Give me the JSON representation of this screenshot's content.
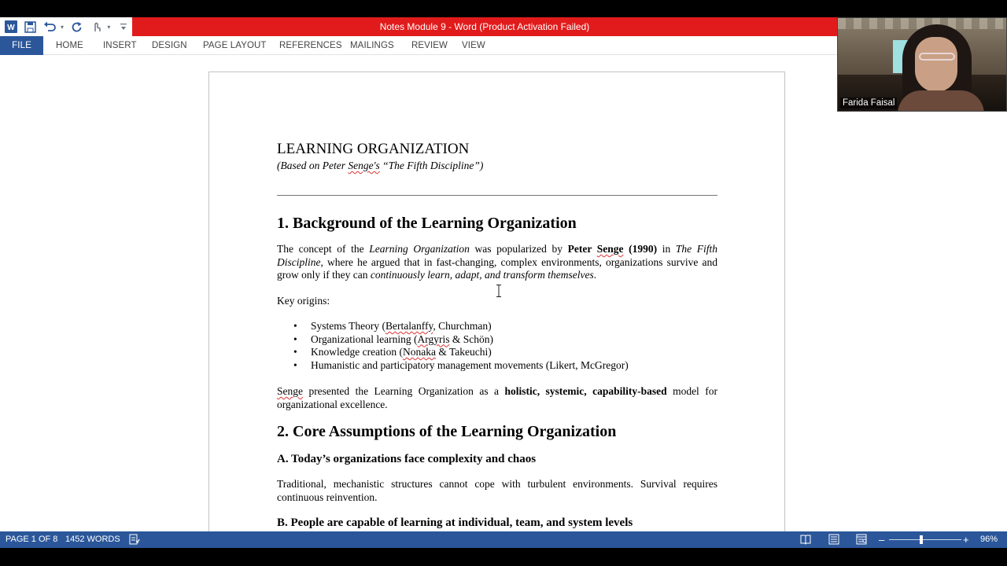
{
  "window": {
    "title": "Notes Module 9  -  Word (Product Activation Failed)"
  },
  "quick_access": {
    "icons": [
      "word-icon",
      "save-icon",
      "undo-icon",
      "redo-icon",
      "touch-mode-icon",
      "customize-icon"
    ]
  },
  "ribbon": {
    "tabs": [
      "FILE",
      "HOME",
      "INSERT",
      "DESIGN",
      "PAGE LAYOUT",
      "REFERENCES",
      "MAILINGS",
      "REVIEW",
      "VIEW"
    ]
  },
  "webcam": {
    "name": "Farida Faisal"
  },
  "document": {
    "title": "LEARNING ORGANIZATION",
    "subtitle_pre": "(Based on Peter ",
    "subtitle_senge": "Senge's",
    "subtitle_post": " “The Fifth Discipline”)",
    "section1": {
      "heading": "1. Background of the Learning Organization",
      "p1": {
        "a": "The concept of the ",
        "b": "Learning Organization",
        "c": " was popularized by ",
        "d": "Peter ",
        "e": "Senge",
        "f": " (1990)",
        "g": " in ",
        "h": "The Fifth Discipline",
        "i": ", where he argued that in fast-changing, complex environments, organizations survive and grow only if they can ",
        "j": "continuously learn, adapt, and transform themselves",
        "k": "."
      },
      "key_origins": "Key origins:",
      "origins": [
        {
          "a": "Systems Theory (",
          "b": "Bertalanffy",
          "c": ", Churchman)"
        },
        {
          "a": "Organizational learning (",
          "b": "Argyris",
          "c": " & Schön)"
        },
        {
          "a": "Knowledge creation (",
          "b": "Nonaka",
          "c": " & Takeuchi)"
        },
        {
          "a": "Humanistic and participatory management movements (Likert, McGregor)",
          "b": "",
          "c": ""
        }
      ],
      "p2": {
        "a": "Senge",
        "b": " presented the Learning Organization as a ",
        "c": "holistic, systemic, capability-based",
        "d": " model for organizational excellence."
      }
    },
    "section2": {
      "heading": "2. Core Assumptions of the Learning Organization",
      "subA": "A. Today’s organizations face complexity and chaos",
      "pA": "Traditional, mechanistic structures cannot cope with turbulent environments. Survival requires continuous reinvention.",
      "subB": "B. People are capable of learning at individual, team, and system levels"
    }
  },
  "statusbar": {
    "page": "PAGE 1 OF 8",
    "words": "1452 WORDS",
    "zoom": "96%",
    "zoom_minus": "–",
    "zoom_plus": "+",
    "zoom_level": 0.45
  },
  "colors": {
    "word_blue": "#2b579a",
    "title_red": "#e11b1b"
  }
}
